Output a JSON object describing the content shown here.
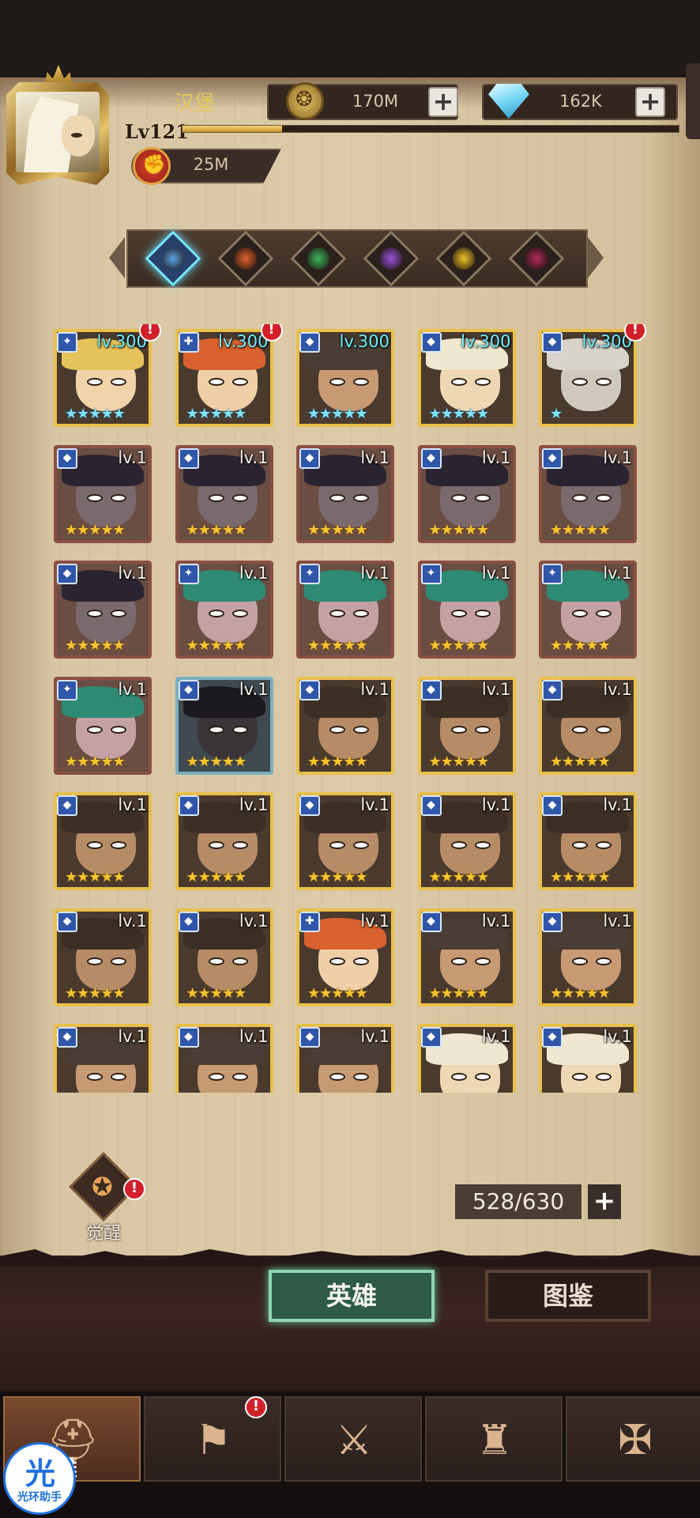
{
  "header": {
    "player_name": "汉堡",
    "level": "Lv121",
    "xp_fraction": 0.2,
    "power": "25M",
    "gold": "170M",
    "gems": "162K"
  },
  "factions": [
    {
      "icon": "light-faction-icon",
      "color": "#5aa3e6",
      "active": true
    },
    {
      "icon": "fire-faction-icon",
      "color": "#e1622c",
      "active": false
    },
    {
      "icon": "nature-faction-icon",
      "color": "#3fb35a",
      "active": false
    },
    {
      "icon": "arcane-faction-icon",
      "color": "#9a52d6",
      "active": false
    },
    {
      "icon": "holy-faction-icon",
      "color": "#f0c22a",
      "active": false
    },
    {
      "icon": "dark-faction-icon",
      "color": "#b02a5a",
      "active": false
    }
  ],
  "heroes": [
    {
      "level": "lv.300",
      "stars": "★★★★★",
      "star_color": "cyan",
      "class": "✦",
      "alert": true,
      "frame": "gold",
      "hair": "#e6c35a",
      "skin": "#f0d3a8"
    },
    {
      "level": "lv.300",
      "stars": "★★★★★",
      "star_color": "cyan",
      "class": "✚",
      "alert": true,
      "frame": "gold",
      "hair": "#d9612e",
      "skin": "#f1cfa6"
    },
    {
      "level": "lv.300",
      "stars": "★★★★★",
      "star_color": "cyan",
      "class": "◆",
      "alert": false,
      "frame": "gold",
      "hair": "#4a3d35",
      "skin": "#c79a74"
    },
    {
      "level": "lv.300",
      "stars": "★★★★★",
      "star_color": "cyan",
      "class": "◆",
      "alert": false,
      "frame": "gold",
      "hair": "#efe7cf",
      "skin": "#eed7b3"
    },
    {
      "level": "lv.300",
      "stars": "★",
      "star_color": "cyan",
      "class": "◆",
      "alert": true,
      "frame": "gold",
      "hair": "#d8d4cc",
      "skin": "#cfc9bd"
    },
    {
      "level": "lv.1",
      "stars": "★★★★★",
      "star_color": "gold",
      "class": "◆",
      "alert": false,
      "frame": "red",
      "hair": "#2a2330",
      "skin": "#7a6a6e"
    },
    {
      "level": "lv.1",
      "stars": "★★★★★",
      "star_color": "gold",
      "class": "◆",
      "alert": false,
      "frame": "red",
      "hair": "#2a2330",
      "skin": "#7a6a6e"
    },
    {
      "level": "lv.1",
      "stars": "★★★★★",
      "star_color": "gold",
      "class": "◆",
      "alert": false,
      "frame": "red",
      "hair": "#2a2330",
      "skin": "#7a6a6e"
    },
    {
      "level": "lv.1",
      "stars": "★★★★★",
      "star_color": "gold",
      "class": "◆",
      "alert": false,
      "frame": "red",
      "hair": "#2a2330",
      "skin": "#7a6a6e"
    },
    {
      "level": "lv.1",
      "stars": "★★★★★",
      "star_color": "gold",
      "class": "◆",
      "alert": false,
      "frame": "red",
      "hair": "#2a2330",
      "skin": "#7a6a6e"
    },
    {
      "level": "lv.1",
      "stars": "★★★★★",
      "star_color": "gold",
      "class": "◆",
      "alert": false,
      "frame": "red",
      "hair": "#2a2330",
      "skin": "#7a6a6e"
    },
    {
      "level": "lv.1",
      "stars": "★★★★★",
      "star_color": "gold",
      "class": "✦",
      "alert": false,
      "frame": "red",
      "hair": "#2f8a74",
      "skin": "#c4a2a4"
    },
    {
      "level": "lv.1",
      "stars": "★★★★★",
      "star_color": "gold",
      "class": "✦",
      "alert": false,
      "frame": "red",
      "hair": "#2f8a74",
      "skin": "#c4a2a4"
    },
    {
      "level": "lv.1",
      "stars": "★★★★★",
      "star_color": "gold",
      "class": "✦",
      "alert": false,
      "frame": "red",
      "hair": "#2f8a74",
      "skin": "#c4a2a4"
    },
    {
      "level": "lv.1",
      "stars": "★★★★★",
      "star_color": "gold",
      "class": "✦",
      "alert": false,
      "frame": "red",
      "hair": "#2f8a74",
      "skin": "#c4a2a4"
    },
    {
      "level": "lv.1",
      "stars": "★★★★★",
      "star_color": "gold",
      "class": "✦",
      "alert": false,
      "frame": "red",
      "hair": "#2f8a74",
      "skin": "#c4a2a4"
    },
    {
      "level": "lv.1",
      "stars": "★★★★★",
      "star_color": "gold",
      "class": "◆",
      "alert": false,
      "frame": "blue",
      "hair": "#1c1a1e",
      "skin": "#3a3438"
    },
    {
      "level": "lv.1",
      "stars": "★★★★★",
      "star_color": "gold",
      "class": "◆",
      "alert": false,
      "frame": "gold",
      "hair": "#3b2e24",
      "skin": "#b68c66"
    },
    {
      "level": "lv.1",
      "stars": "★★★★★",
      "star_color": "gold",
      "class": "◆",
      "alert": false,
      "frame": "gold",
      "hair": "#3b2e24",
      "skin": "#b68c66"
    },
    {
      "level": "lv.1",
      "stars": "★★★★★",
      "star_color": "gold",
      "class": "◆",
      "alert": false,
      "frame": "gold",
      "hair": "#3b2e24",
      "skin": "#b68c66"
    },
    {
      "level": "lv.1",
      "stars": "★★★★★",
      "star_color": "gold",
      "class": "◆",
      "alert": false,
      "frame": "gold",
      "hair": "#3b2e24",
      "skin": "#b68c66"
    },
    {
      "level": "lv.1",
      "stars": "★★★★★",
      "star_color": "gold",
      "class": "◆",
      "alert": false,
      "frame": "gold",
      "hair": "#3b2e24",
      "skin": "#b68c66"
    },
    {
      "level": "lv.1",
      "stars": "★★★★★",
      "star_color": "gold",
      "class": "◆",
      "alert": false,
      "frame": "gold",
      "hair": "#3b2e24",
      "skin": "#b68c66"
    },
    {
      "level": "lv.1",
      "stars": "★★★★★",
      "star_color": "gold",
      "class": "◆",
      "alert": false,
      "frame": "gold",
      "hair": "#3b2e24",
      "skin": "#b68c66"
    },
    {
      "level": "lv.1",
      "stars": "★★★★★",
      "star_color": "gold",
      "class": "◆",
      "alert": false,
      "frame": "gold",
      "hair": "#3b2e24",
      "skin": "#b68c66"
    },
    {
      "level": "lv.1",
      "stars": "★★★★★",
      "star_color": "gold",
      "class": "◆",
      "alert": false,
      "frame": "gold",
      "hair": "#3b2e24",
      "skin": "#b68c66"
    },
    {
      "level": "lv.1",
      "stars": "★★★★★",
      "star_color": "gold",
      "class": "◆",
      "alert": false,
      "frame": "gold",
      "hair": "#3b2e24",
      "skin": "#b68c66"
    },
    {
      "level": "lv.1",
      "stars": "★★★★★",
      "star_color": "gold",
      "class": "✚",
      "alert": false,
      "frame": "gold",
      "hair": "#d9612e",
      "skin": "#f1cfa6"
    },
    {
      "level": "lv.1",
      "stars": "★★★★★",
      "star_color": "gold",
      "class": "◆",
      "alert": false,
      "frame": "gold",
      "hair": "#4a3d35",
      "skin": "#c79a74"
    },
    {
      "level": "lv.1",
      "stars": "★★★★★",
      "star_color": "gold",
      "class": "◆",
      "alert": false,
      "frame": "gold",
      "hair": "#4a3d35",
      "skin": "#c79a74"
    },
    {
      "level": "lv.1",
      "stars": "★★★★★",
      "star_color": "gold",
      "class": "◆",
      "alert": false,
      "frame": "gold",
      "hair": "#4a3d35",
      "skin": "#c79a74"
    },
    {
      "level": "lv.1",
      "stars": "★★★★★",
      "star_color": "gold",
      "class": "◆",
      "alert": false,
      "frame": "gold",
      "hair": "#4a3d35",
      "skin": "#c79a74"
    },
    {
      "level": "lv.1",
      "stars": "★★★★★",
      "star_color": "gold",
      "class": "◆",
      "alert": false,
      "frame": "gold",
      "hair": "#4a3d35",
      "skin": "#c79a74"
    },
    {
      "level": "lv.1",
      "stars": "★★★★★",
      "star_color": "gold",
      "class": "◆",
      "alert": false,
      "frame": "gold",
      "hair": "#efe7cf",
      "skin": "#eed7b3"
    },
    {
      "level": "lv.1",
      "stars": "★★★★★",
      "star_color": "gold",
      "class": "◆",
      "alert": false,
      "frame": "gold",
      "hair": "#efe7cf",
      "skin": "#eed7b3"
    }
  ],
  "awaken": {
    "label": "觉醒",
    "alert": true
  },
  "capacity": "528/630",
  "tabs": {
    "heroes": "英雄",
    "codex": "图鉴"
  },
  "nav": [
    {
      "icon": "hero-helmet-icon",
      "label": "雄",
      "active": true,
      "alert": false
    },
    {
      "icon": "adventure-flag-icon",
      "label": "",
      "active": false,
      "alert": true
    },
    {
      "icon": "battle-swords-icon",
      "label": "",
      "active": false,
      "alert": false
    },
    {
      "icon": "castle-icon",
      "label": "",
      "active": false,
      "alert": false
    },
    {
      "icon": "guild-crest-icon",
      "label": "",
      "active": false,
      "alert": false
    }
  ],
  "assistant": {
    "mark": "光",
    "label": "光环助手"
  }
}
